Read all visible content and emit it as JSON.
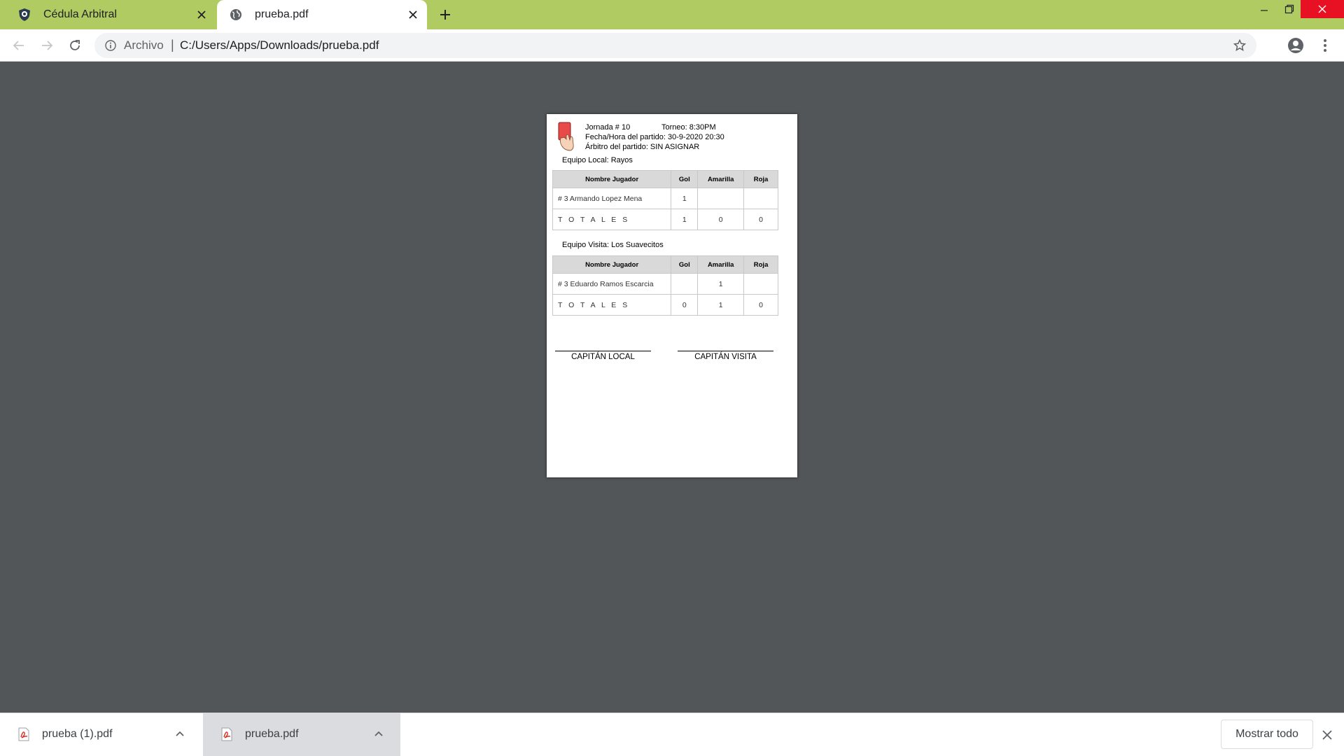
{
  "browser": {
    "tabs": [
      {
        "title": "Cédula Arbitral",
        "favicon": "shield-badge-icon",
        "active": false
      },
      {
        "title": "prueba.pdf",
        "favicon": "globe-icon",
        "active": true
      }
    ],
    "address": {
      "scheme": "Archivo",
      "separator": "|",
      "url": "C:/Users/Apps/Downloads/prueba.pdf"
    },
    "colors": {
      "tabstrip": "#b0cb62",
      "close": "#e81123",
      "viewer_bg": "#525659"
    }
  },
  "document": {
    "header": {
      "jornada": "Jornada # 10",
      "torneo": "Torneo: 8:30PM",
      "fecha": "Fecha/Hora del partido: 30-9-2020 20:30",
      "arbitro": "Árbitro del partido: SIN ASIGNAR"
    },
    "local": {
      "team": "Equipo Local: Rayos",
      "columns": [
        "Nombre Jugador",
        "Gol",
        "Amarilla",
        "Roja"
      ],
      "rows": [
        [
          "# 3 Armando Lopez Mena",
          "1",
          "",
          ""
        ]
      ],
      "totals": [
        "T O T A L E S",
        "1",
        "0",
        "0"
      ]
    },
    "visita": {
      "team": "Equipo Visita: Los Suavecitos",
      "columns": [
        "Nombre Jugador",
        "Gol",
        "Amarilla",
        "Roja"
      ],
      "rows": [
        [
          "# 3 Eduardo Ramos Escarcia",
          "",
          "1",
          ""
        ]
      ],
      "totals": [
        "T O T A L E S",
        "0",
        "1",
        "0"
      ]
    },
    "signatures": [
      "CAPITÁN LOCAL",
      "CAPITÁN VISITA"
    ]
  },
  "downloads": {
    "items": [
      {
        "name": "prueba (1).pdf",
        "icon": "pdf-file-icon"
      },
      {
        "name": "prueba.pdf",
        "icon": "pdf-file-icon"
      }
    ],
    "show_all": "Mostrar todo"
  }
}
